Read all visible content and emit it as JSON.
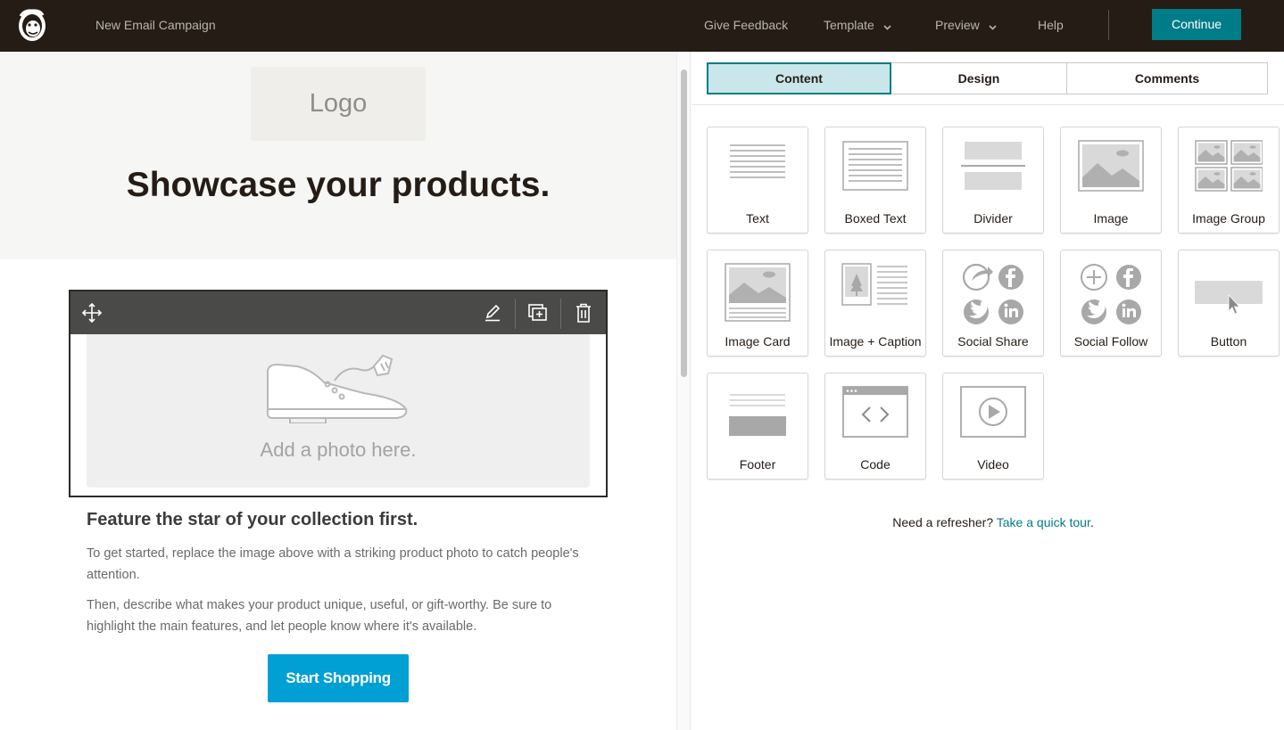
{
  "topbar": {
    "logo_icon": "freddie-monkey-logo-icon",
    "campaign_title": "New Email Campaign",
    "nav": {
      "give_feedback": "Give Feedback",
      "template": "Template",
      "preview": "Preview",
      "help": "Help"
    },
    "continue_label": "Continue",
    "colors": {
      "bar": "#241c15",
      "continue": "#007c89"
    }
  },
  "editor": {
    "logo_placeholder": "Logo",
    "headline": "Showcase your products.",
    "toolbar_icons": [
      "move-icon",
      "pencil-icon",
      "duplicate-icon",
      "trash-icon"
    ],
    "photo_placeholder": "Add a photo here.",
    "photo_icon": "shoe-icon",
    "feature_title": "Feature the star of your collection first.",
    "paragraph_1": "To get started, replace the image above with a striking product photo to catch people's attention.",
    "paragraph_2": "Then, describe what makes your product unique, useful, or gift-worthy. Be sure to highlight the main features, and let people know where it's available.",
    "cta_label": "Start Shopping",
    "cta_color": "#009fd4"
  },
  "panel": {
    "tabs": [
      {
        "label": "Content",
        "active": true
      },
      {
        "label": "Design",
        "active": false
      },
      {
        "label": "Comments",
        "active": false
      }
    ],
    "blocks": [
      {
        "label": "Text",
        "icon": "text-block-icon"
      },
      {
        "label": "Boxed Text",
        "icon": "boxed-text-block-icon"
      },
      {
        "label": "Divider",
        "icon": "divider-block-icon"
      },
      {
        "label": "Image",
        "icon": "image-block-icon"
      },
      {
        "label": "Image Group",
        "icon": "image-group-block-icon"
      },
      {
        "label": "Image Card",
        "icon": "image-card-block-icon"
      },
      {
        "label": "Image + Caption",
        "icon": "image-caption-block-icon"
      },
      {
        "label": "Social Share",
        "icon": "social-share-block-icon"
      },
      {
        "label": "Social Follow",
        "icon": "social-follow-block-icon"
      },
      {
        "label": "Button",
        "icon": "button-block-icon"
      },
      {
        "label": "Footer",
        "icon": "footer-block-icon"
      },
      {
        "label": "Code",
        "icon": "code-block-icon"
      },
      {
        "label": "Video",
        "icon": "video-block-icon"
      }
    ],
    "refresher_text": "Need a refresher?",
    "refresher_link": "Take a quick tour",
    "refresher_end": ".",
    "accent": "#007c89"
  }
}
